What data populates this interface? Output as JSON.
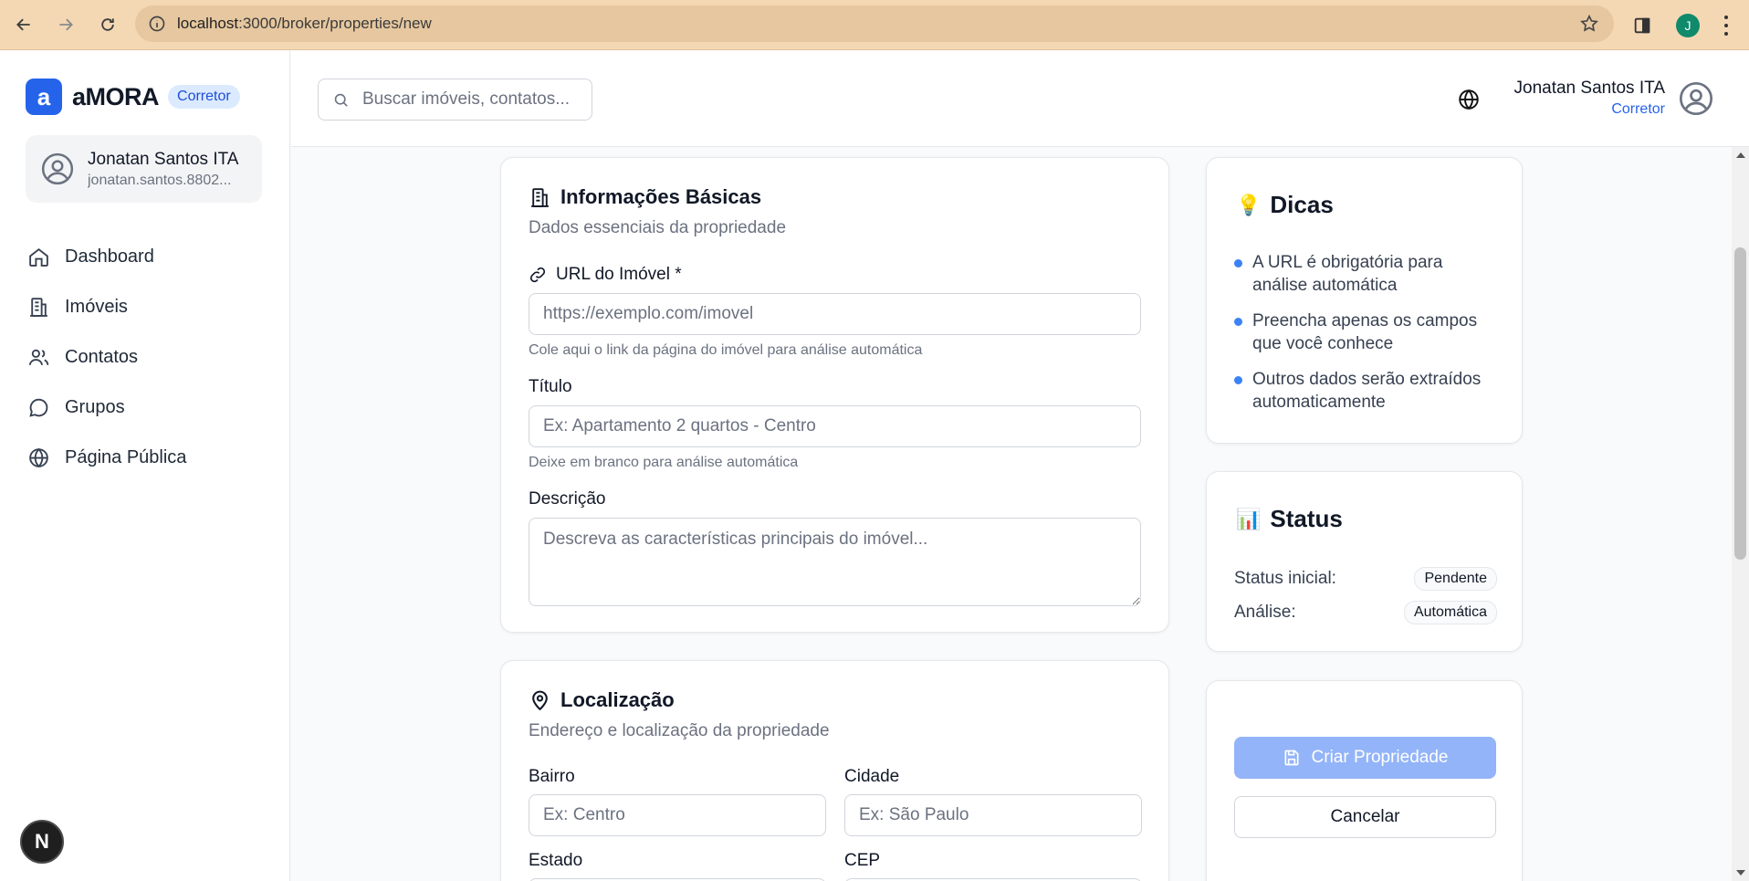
{
  "browser": {
    "url_host": "localhost",
    "url_rest": ":3000/broker/properties/new",
    "profile_initial": "J"
  },
  "sidebar": {
    "brand_logo": "a",
    "brand_name": "aMORA",
    "brand_badge": "Corretor",
    "user": {
      "name": "Jonatan Santos ITA",
      "email": "jonatan.santos.8802..."
    },
    "items": [
      {
        "label": "Dashboard",
        "icon": "home-icon"
      },
      {
        "label": "Imóveis",
        "icon": "building-icon"
      },
      {
        "label": "Contatos",
        "icon": "users-icon"
      },
      {
        "label": "Grupos",
        "icon": "chat-icon"
      },
      {
        "label": "Página Pública",
        "icon": "globe-icon"
      }
    ],
    "dev_badge": "N"
  },
  "header": {
    "search_placeholder": "Buscar imóveis, contatos...",
    "user_name": "Jonatan Santos ITA",
    "user_role": "Corretor"
  },
  "basic_info": {
    "title": "Informações Básicas",
    "subtitle": "Dados essenciais da propriedade",
    "url_label": "URL do Imóvel *",
    "url_placeholder": "https://exemplo.com/imovel",
    "url_hint": "Cole aqui o link da página do imóvel para análise automática",
    "title_label": "Título",
    "title_placeholder": "Ex: Apartamento 2 quartos - Centro",
    "title_hint": "Deixe em branco para análise automática",
    "desc_label": "Descrição",
    "desc_placeholder": "Descreva as características principais do imóvel..."
  },
  "location": {
    "title": "Localização",
    "subtitle": "Endereço e localização da propriedade",
    "bairro_label": "Bairro",
    "bairro_placeholder": "Ex: Centro",
    "cidade_label": "Cidade",
    "cidade_placeholder": "Ex: São Paulo",
    "estado_label": "Estado",
    "cep_label": "CEP"
  },
  "tips": {
    "emoji": "💡",
    "title": "Dicas",
    "items": [
      "A URL é obrigatória para análise automática",
      "Preencha apenas os campos que você conhece",
      "Outros dados serão extraídos automaticamente"
    ]
  },
  "status": {
    "emoji": "📊",
    "title": "Status",
    "initial_label": "Status inicial:",
    "initial_value": "Pendente",
    "analysis_label": "Análise:",
    "analysis_value": "Automática"
  },
  "actions": {
    "create_label": "Criar Propriedade",
    "cancel_label": "Cancelar"
  },
  "colors": {
    "brand": "#2563eb",
    "chrome": "#f4d8b4",
    "primary_disabled": "#93b4f8",
    "bullet": "#3b82f6"
  }
}
